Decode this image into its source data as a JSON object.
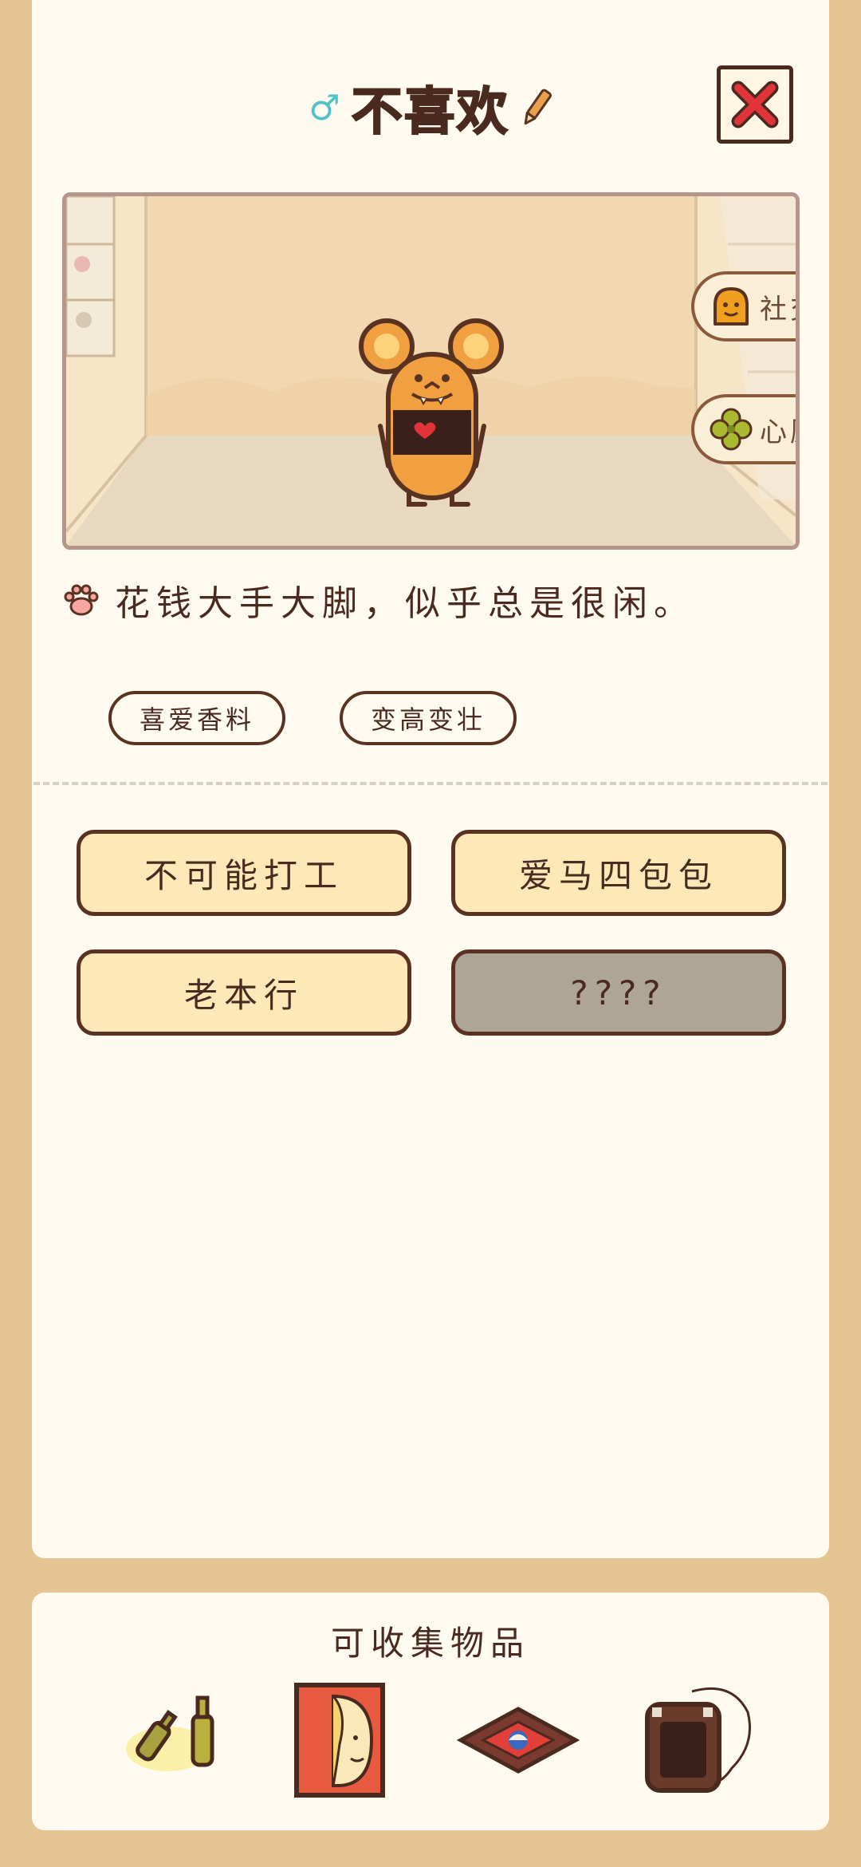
{
  "header": {
    "gender_symbol": "♂",
    "name": "不喜欢"
  },
  "scene": {
    "side_buttons": [
      {
        "label": "社交",
        "icon": "social-icon"
      },
      {
        "label": "心愿",
        "icon": "clover-icon"
      }
    ]
  },
  "description": "花钱大手大脚，似乎总是很闲。",
  "tags": [
    "喜爱香料",
    "变高变壮"
  ],
  "traits": [
    {
      "label": "不可能打工",
      "locked": false
    },
    {
      "label": "爱马四包包",
      "locked": false
    },
    {
      "label": "老本行",
      "locked": false
    },
    {
      "label": "????",
      "locked": true
    }
  ],
  "collectibles": {
    "title": "可收集物品",
    "items": [
      "bottles-icon",
      "super-poster-icon",
      "rug-icon",
      "backpack-icon"
    ]
  },
  "colors": {
    "background": "#e3c492",
    "card": "#fefaf0",
    "trait_button": "#ffe8b8",
    "locked_button": "#aea596",
    "close_x": "#e0333a",
    "gender": "#4fc2c8"
  }
}
